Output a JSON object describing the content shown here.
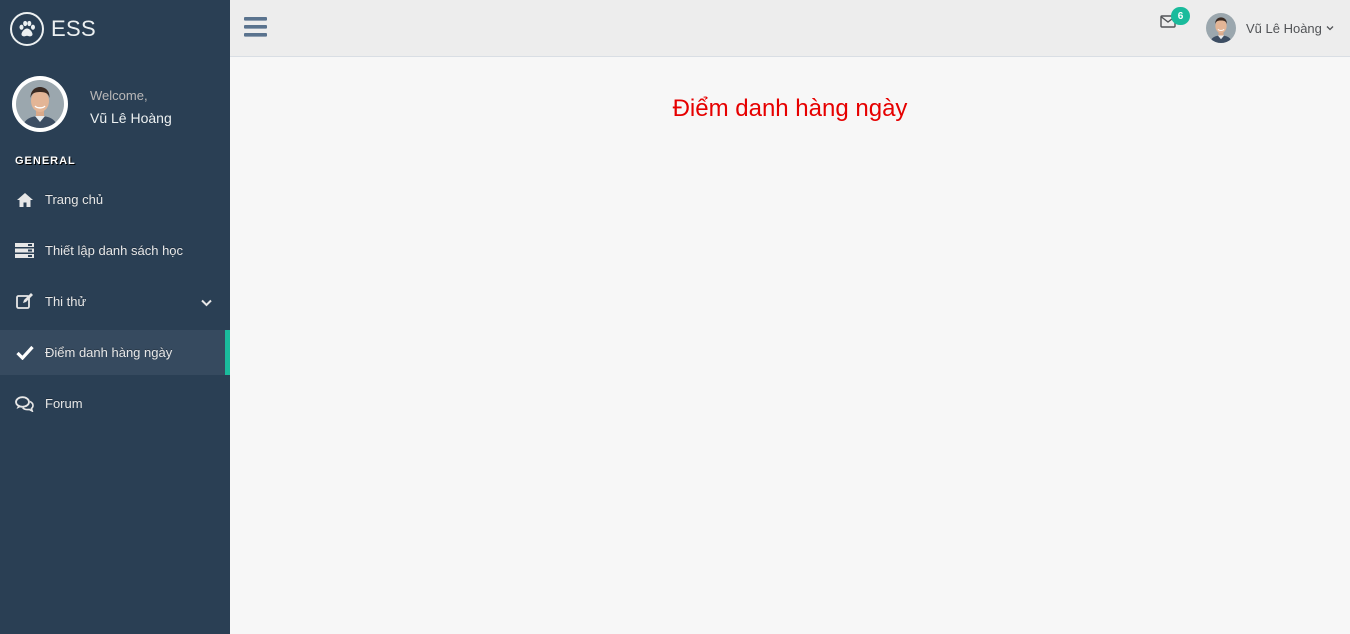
{
  "app": {
    "title": "ESS"
  },
  "profile": {
    "welcome": "Welcome,",
    "name": "Vũ Lê Hoàng"
  },
  "sidebar": {
    "section_title": "GENERAL",
    "items": [
      {
        "label": "Trang chủ",
        "icon": "home-icon"
      },
      {
        "label": "Thiết lập danh sách học",
        "icon": "list-icon"
      },
      {
        "label": "Thi thử",
        "icon": "edit-icon",
        "has_submenu": true
      },
      {
        "label": "Điểm danh hàng ngày",
        "icon": "check-icon",
        "active": true
      },
      {
        "label": "Forum",
        "icon": "comments-icon"
      }
    ]
  },
  "topbar": {
    "mail_count": "6",
    "user_name": "Vũ Lê Hoàng"
  },
  "main": {
    "title": "Điểm danh hàng ngày"
  },
  "colors": {
    "sidebar_bg": "#2A3F54",
    "active_item_bg": "#364A5F",
    "accent": "#1ABB9C",
    "title_red": "#E60000",
    "topbar_bg": "#EDEDED",
    "content_bg": "#F7F7F7"
  }
}
